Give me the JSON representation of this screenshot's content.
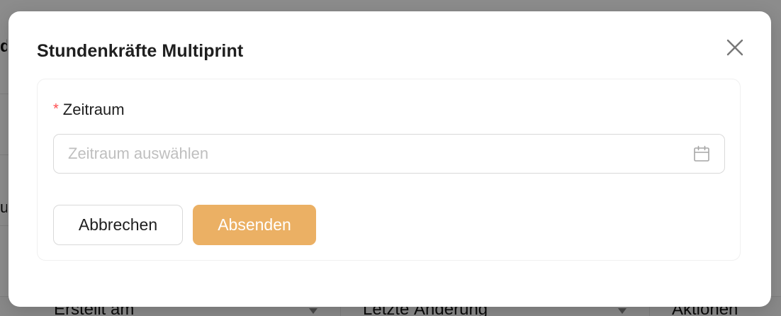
{
  "modal": {
    "title": "Stundenkräfte Multiprint",
    "close_icon": "close-icon",
    "form": {
      "period_field": {
        "label": "Zeitraum",
        "required_mark": "*",
        "placeholder": "Zeitraum auswählen",
        "value": "",
        "icon": "calendar-icon"
      },
      "buttons": {
        "cancel_label": "Abbrechen",
        "submit_label": "Absenden"
      }
    }
  },
  "background": {
    "table_headers": [
      "Erstellt am",
      "Letzte Änderung",
      "Aktionen"
    ]
  },
  "colors": {
    "primary": "#ebb064",
    "required": "#ff4d4f",
    "placeholder": "#bfbfbf",
    "border": "#d9d9d9"
  }
}
